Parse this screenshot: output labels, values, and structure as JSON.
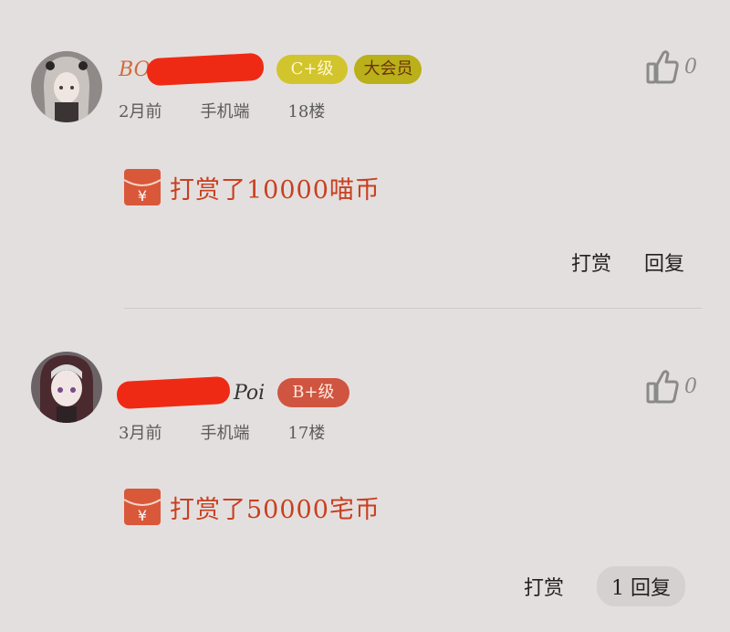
{
  "comments": [
    {
      "username_visible": "BO",
      "badges": [
        "C+级",
        "大会员"
      ],
      "time": "2月前",
      "device": "手机端",
      "floor": "18楼",
      "likes": "0",
      "reward_text": "打赏了10000喵币",
      "tip_label": "打赏",
      "reply_label": "回复"
    },
    {
      "username_visible": "Poi",
      "badges": [
        "B+级"
      ],
      "time": "3月前",
      "device": "手机端",
      "floor": "17楼",
      "likes": "0",
      "reward_text": "打赏了50000宅币",
      "tip_label": "打赏",
      "reply_label": "1 回复"
    }
  ],
  "icons": {
    "like": "thumbs-up-icon",
    "envelope": "red-envelope-icon",
    "envelope_symbol": "¥"
  },
  "colors": {
    "background": "#e4dfdf",
    "reward": "#c8401f",
    "redaction": "#ef2a14"
  }
}
